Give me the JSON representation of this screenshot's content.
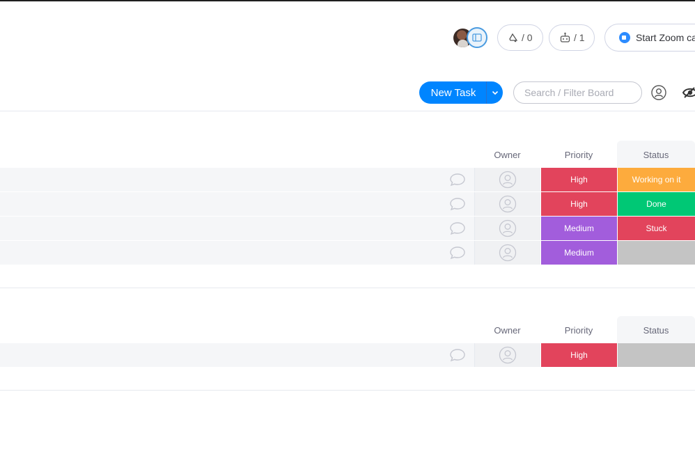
{
  "header": {
    "activity_count": "/ 0",
    "automation_count": "/ 1",
    "zoom_label": "Start Zoom ca"
  },
  "toolbar": {
    "new_task_label": "New Task",
    "search_placeholder": "Search / Filter Board"
  },
  "columns": {
    "owner": "Owner",
    "priority": "Priority",
    "status": "Status"
  },
  "groups": [
    {
      "rows": [
        {
          "priority": "High",
          "status": "Working on it"
        },
        {
          "priority": "High",
          "status": "Done"
        },
        {
          "priority": "Medium",
          "status": "Stuck"
        },
        {
          "priority": "Medium",
          "status": ""
        }
      ]
    },
    {
      "rows": [
        {
          "priority": "High",
          "status": ""
        }
      ]
    }
  ],
  "colors": {
    "primary": "#0085ff",
    "high": "#e2445c",
    "medium": "#a25ddc",
    "working_on_it": "#fdab3d",
    "done": "#00c875",
    "stuck": "#e2445c",
    "empty_status": "#c4c4c4"
  },
  "icons": {
    "activity": "activity-icon",
    "automation": "robot-icon",
    "zoom": "zoom-icon",
    "owner": "person-placeholder-icon",
    "updates": "speech-bubble-icon",
    "visibility": "eye-icon"
  }
}
